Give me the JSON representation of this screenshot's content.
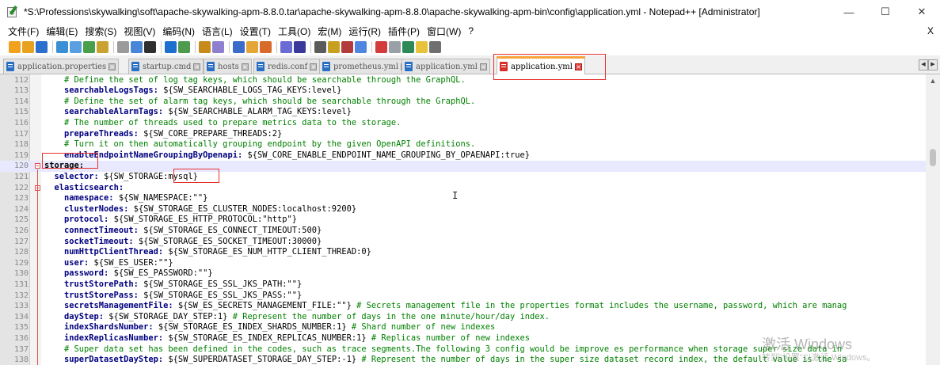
{
  "window": {
    "title": "*S:\\Professions\\skywalking\\soft\\apache-skywalking-apm-8.8.0.tar\\apache-skywalking-apm-8.8.0\\apache-skywalking-apm-bin\\config\\application.yml - Notepad++ [Administrator]",
    "minimize": "—",
    "maximize": "☐",
    "close": "✕"
  },
  "menu": {
    "items": [
      "文件(F)",
      "编辑(E)",
      "搜索(S)",
      "视图(V)",
      "编码(N)",
      "语言(L)",
      "设置(T)",
      "工具(O)",
      "宏(M)",
      "运行(R)",
      "插件(P)",
      "窗口(W)",
      "?"
    ],
    "close_doc": "X"
  },
  "toolbar": {
    "colors": [
      "#f2a11c",
      "#e8a21f",
      "#2c6fcc",
      "#3b8fd4",
      "#5aa0e0",
      "#4aa04a",
      "#c9a232",
      "#9b9b9b",
      "#4a86d8",
      "#2f2f2f",
      "#1f6fcf",
      "#4e9a4e",
      "#c88a1a",
      "#8f7fd0",
      "#3b6ccc",
      "#e3a637",
      "#d86a2a",
      "#6b6bd6",
      "#3a3a9a",
      "#5b5b5b",
      "#c8a020",
      "#b33b3b",
      "#4f86e0",
      "#d43c3c",
      "#9aa0a8",
      "#2d8a57",
      "#e8c23a",
      "#6f6f6f"
    ]
  },
  "tabs": [
    {
      "label": "application.properties",
      "state": "saved"
    },
    {
      "label": "startup.cmd",
      "state": "saved"
    },
    {
      "label": "hosts",
      "state": "saved"
    },
    {
      "label": "redis.conf",
      "state": "saved"
    },
    {
      "label": "prometheus.yml",
      "state": "saved"
    },
    {
      "label": "application.yml",
      "state": "saved"
    },
    {
      "label": "application.yml",
      "state": "unsaved",
      "active": true
    }
  ],
  "tab_scroll": {
    "left": "◀",
    "right": "▶"
  },
  "editor": {
    "lines": [
      {
        "n": "112",
        "indent": 4,
        "parts": [
          {
            "c": "cm",
            "t": "# Define the set of log tag keys, which should be searchable through the GraphQL."
          }
        ]
      },
      {
        "n": "113",
        "indent": 4,
        "parts": [
          {
            "c": "key",
            "t": "searchableLogsTags:"
          },
          {
            "c": "val",
            "t": " ${SW_SEARCHABLE_LOGS_TAG_KEYS:level}"
          }
        ]
      },
      {
        "n": "114",
        "indent": 4,
        "parts": [
          {
            "c": "cm",
            "t": "# Define the set of alarm tag keys, which should be searchable through the GraphQL."
          }
        ]
      },
      {
        "n": "115",
        "indent": 4,
        "parts": [
          {
            "c": "key",
            "t": "searchableAlarmTags:"
          },
          {
            "c": "val",
            "t": " ${SW_SEARCHABLE_ALARM_TAG_KEYS:level}"
          }
        ]
      },
      {
        "n": "116",
        "indent": 4,
        "parts": [
          {
            "c": "cm",
            "t": "# The number of threads used to prepare metrics data to the storage."
          }
        ]
      },
      {
        "n": "117",
        "indent": 4,
        "parts": [
          {
            "c": "key",
            "t": "prepareThreads:"
          },
          {
            "c": "val",
            "t": " ${SW_CORE_PREPARE_THREADS:2}"
          }
        ]
      },
      {
        "n": "118",
        "indent": 4,
        "parts": [
          {
            "c": "cm",
            "t": "# Turn it on then automatically grouping endpoint by the given OpenAPI definitions."
          }
        ]
      },
      {
        "n": "119",
        "indent": 4,
        "parts": [
          {
            "c": "key",
            "t": "enableEndpointNameGroupingByOpenapi:"
          },
          {
            "c": "val",
            "t": " ${SW_CORE_ENABLE_ENDPOINT_NAME_GROUPING_BY_OPAENAPI:true}"
          }
        ]
      },
      {
        "n": "120",
        "indent": 0,
        "fold": true,
        "current": true,
        "parts": [
          {
            "c": "k0",
            "t": "storage:"
          }
        ]
      },
      {
        "n": "121",
        "indent": 2,
        "parts": [
          {
            "c": "key",
            "t": "selector:"
          },
          {
            "c": "val",
            "t": " ${SW_STORAGE:mysql}"
          }
        ]
      },
      {
        "n": "122",
        "indent": 2,
        "fold": true,
        "parts": [
          {
            "c": "key",
            "t": "elasticsearch:"
          }
        ]
      },
      {
        "n": "123",
        "indent": 4,
        "parts": [
          {
            "c": "key",
            "t": "namespace:"
          },
          {
            "c": "val",
            "t": " ${SW_NAMESPACE:\"\"}"
          }
        ]
      },
      {
        "n": "124",
        "indent": 4,
        "parts": [
          {
            "c": "key",
            "t": "clusterNodes:"
          },
          {
            "c": "val",
            "t": " ${SW_STORAGE_ES_CLUSTER_NODES:localhost:9200}"
          }
        ]
      },
      {
        "n": "125",
        "indent": 4,
        "parts": [
          {
            "c": "key",
            "t": "protocol:"
          },
          {
            "c": "val",
            "t": " ${SW_STORAGE_ES_HTTP_PROTOCOL:\"http\"}"
          }
        ]
      },
      {
        "n": "126",
        "indent": 4,
        "parts": [
          {
            "c": "key",
            "t": "connectTimeout:"
          },
          {
            "c": "val",
            "t": " ${SW_STORAGE_ES_CONNECT_TIMEOUT:500}"
          }
        ]
      },
      {
        "n": "127",
        "indent": 4,
        "parts": [
          {
            "c": "key",
            "t": "socketTimeout:"
          },
          {
            "c": "val",
            "t": " ${SW_STORAGE_ES_SOCKET_TIMEOUT:30000}"
          }
        ]
      },
      {
        "n": "128",
        "indent": 4,
        "parts": [
          {
            "c": "key",
            "t": "numHttpClientThread:"
          },
          {
            "c": "val",
            "t": " ${SW_STORAGE_ES_NUM_HTTP_CLIENT_THREAD:0}"
          }
        ]
      },
      {
        "n": "129",
        "indent": 4,
        "parts": [
          {
            "c": "key",
            "t": "user:"
          },
          {
            "c": "val",
            "t": " ${SW_ES_USER:\"\"}"
          }
        ]
      },
      {
        "n": "130",
        "indent": 4,
        "parts": [
          {
            "c": "key",
            "t": "password:"
          },
          {
            "c": "val",
            "t": " ${SW_ES_PASSWORD:\"\"}"
          }
        ]
      },
      {
        "n": "131",
        "indent": 4,
        "parts": [
          {
            "c": "key",
            "t": "trustStorePath:"
          },
          {
            "c": "val",
            "t": " ${SW_STORAGE_ES_SSL_JKS_PATH:\"\"}"
          }
        ]
      },
      {
        "n": "132",
        "indent": 4,
        "parts": [
          {
            "c": "key",
            "t": "trustStorePass:"
          },
          {
            "c": "val",
            "t": " ${SW_STORAGE_ES_SSL_JKS_PASS:\"\"}"
          }
        ]
      },
      {
        "n": "133",
        "indent": 4,
        "parts": [
          {
            "c": "key",
            "t": "secretsManagementFile:"
          },
          {
            "c": "val",
            "t": " ${SW_ES_SECRETS_MANAGEMENT_FILE:\"\"} "
          },
          {
            "c": "cm",
            "t": "# Secrets management file in the properties format includes the username, password, which are manag"
          }
        ]
      },
      {
        "n": "134",
        "indent": 4,
        "parts": [
          {
            "c": "key",
            "t": "dayStep:"
          },
          {
            "c": "val",
            "t": " ${SW_STORAGE_DAY_STEP:1} "
          },
          {
            "c": "cm",
            "t": "# Represent the number of days in the one minute/hour/day index."
          }
        ]
      },
      {
        "n": "135",
        "indent": 4,
        "parts": [
          {
            "c": "key",
            "t": "indexShardsNumber:"
          },
          {
            "c": "val",
            "t": " ${SW_STORAGE_ES_INDEX_SHARDS_NUMBER:1} "
          },
          {
            "c": "cm",
            "t": "# Shard number of new indexes"
          }
        ]
      },
      {
        "n": "136",
        "indent": 4,
        "parts": [
          {
            "c": "key",
            "t": "indexReplicasNumber:"
          },
          {
            "c": "val",
            "t": " ${SW_STORAGE_ES_INDEX_REPLICAS_NUMBER:1} "
          },
          {
            "c": "cm",
            "t": "# Replicas number of new indexes"
          }
        ]
      },
      {
        "n": "137",
        "indent": 4,
        "parts": [
          {
            "c": "cm",
            "t": "# Super data set has been defined in the codes, such as trace segments.The following 3 config would be improve es performance when storage super size data in"
          }
        ]
      },
      {
        "n": "138",
        "indent": 4,
        "parts": [
          {
            "c": "key",
            "t": "superDatasetDayStep:"
          },
          {
            "c": "val",
            "t": " ${SW_SUPERDATASET_STORAGE_DAY_STEP:-1} "
          },
          {
            "c": "cm",
            "t": "# Represent the number of days in the super size dataset record index, the default value is the sa"
          }
        ]
      }
    ]
  },
  "scrollbar": {
    "up": "▲"
  },
  "cursor": "I",
  "watermark": {
    "line1": "激活 Windows",
    "line2": "转到\"设置\"以激活 Windows。"
  }
}
